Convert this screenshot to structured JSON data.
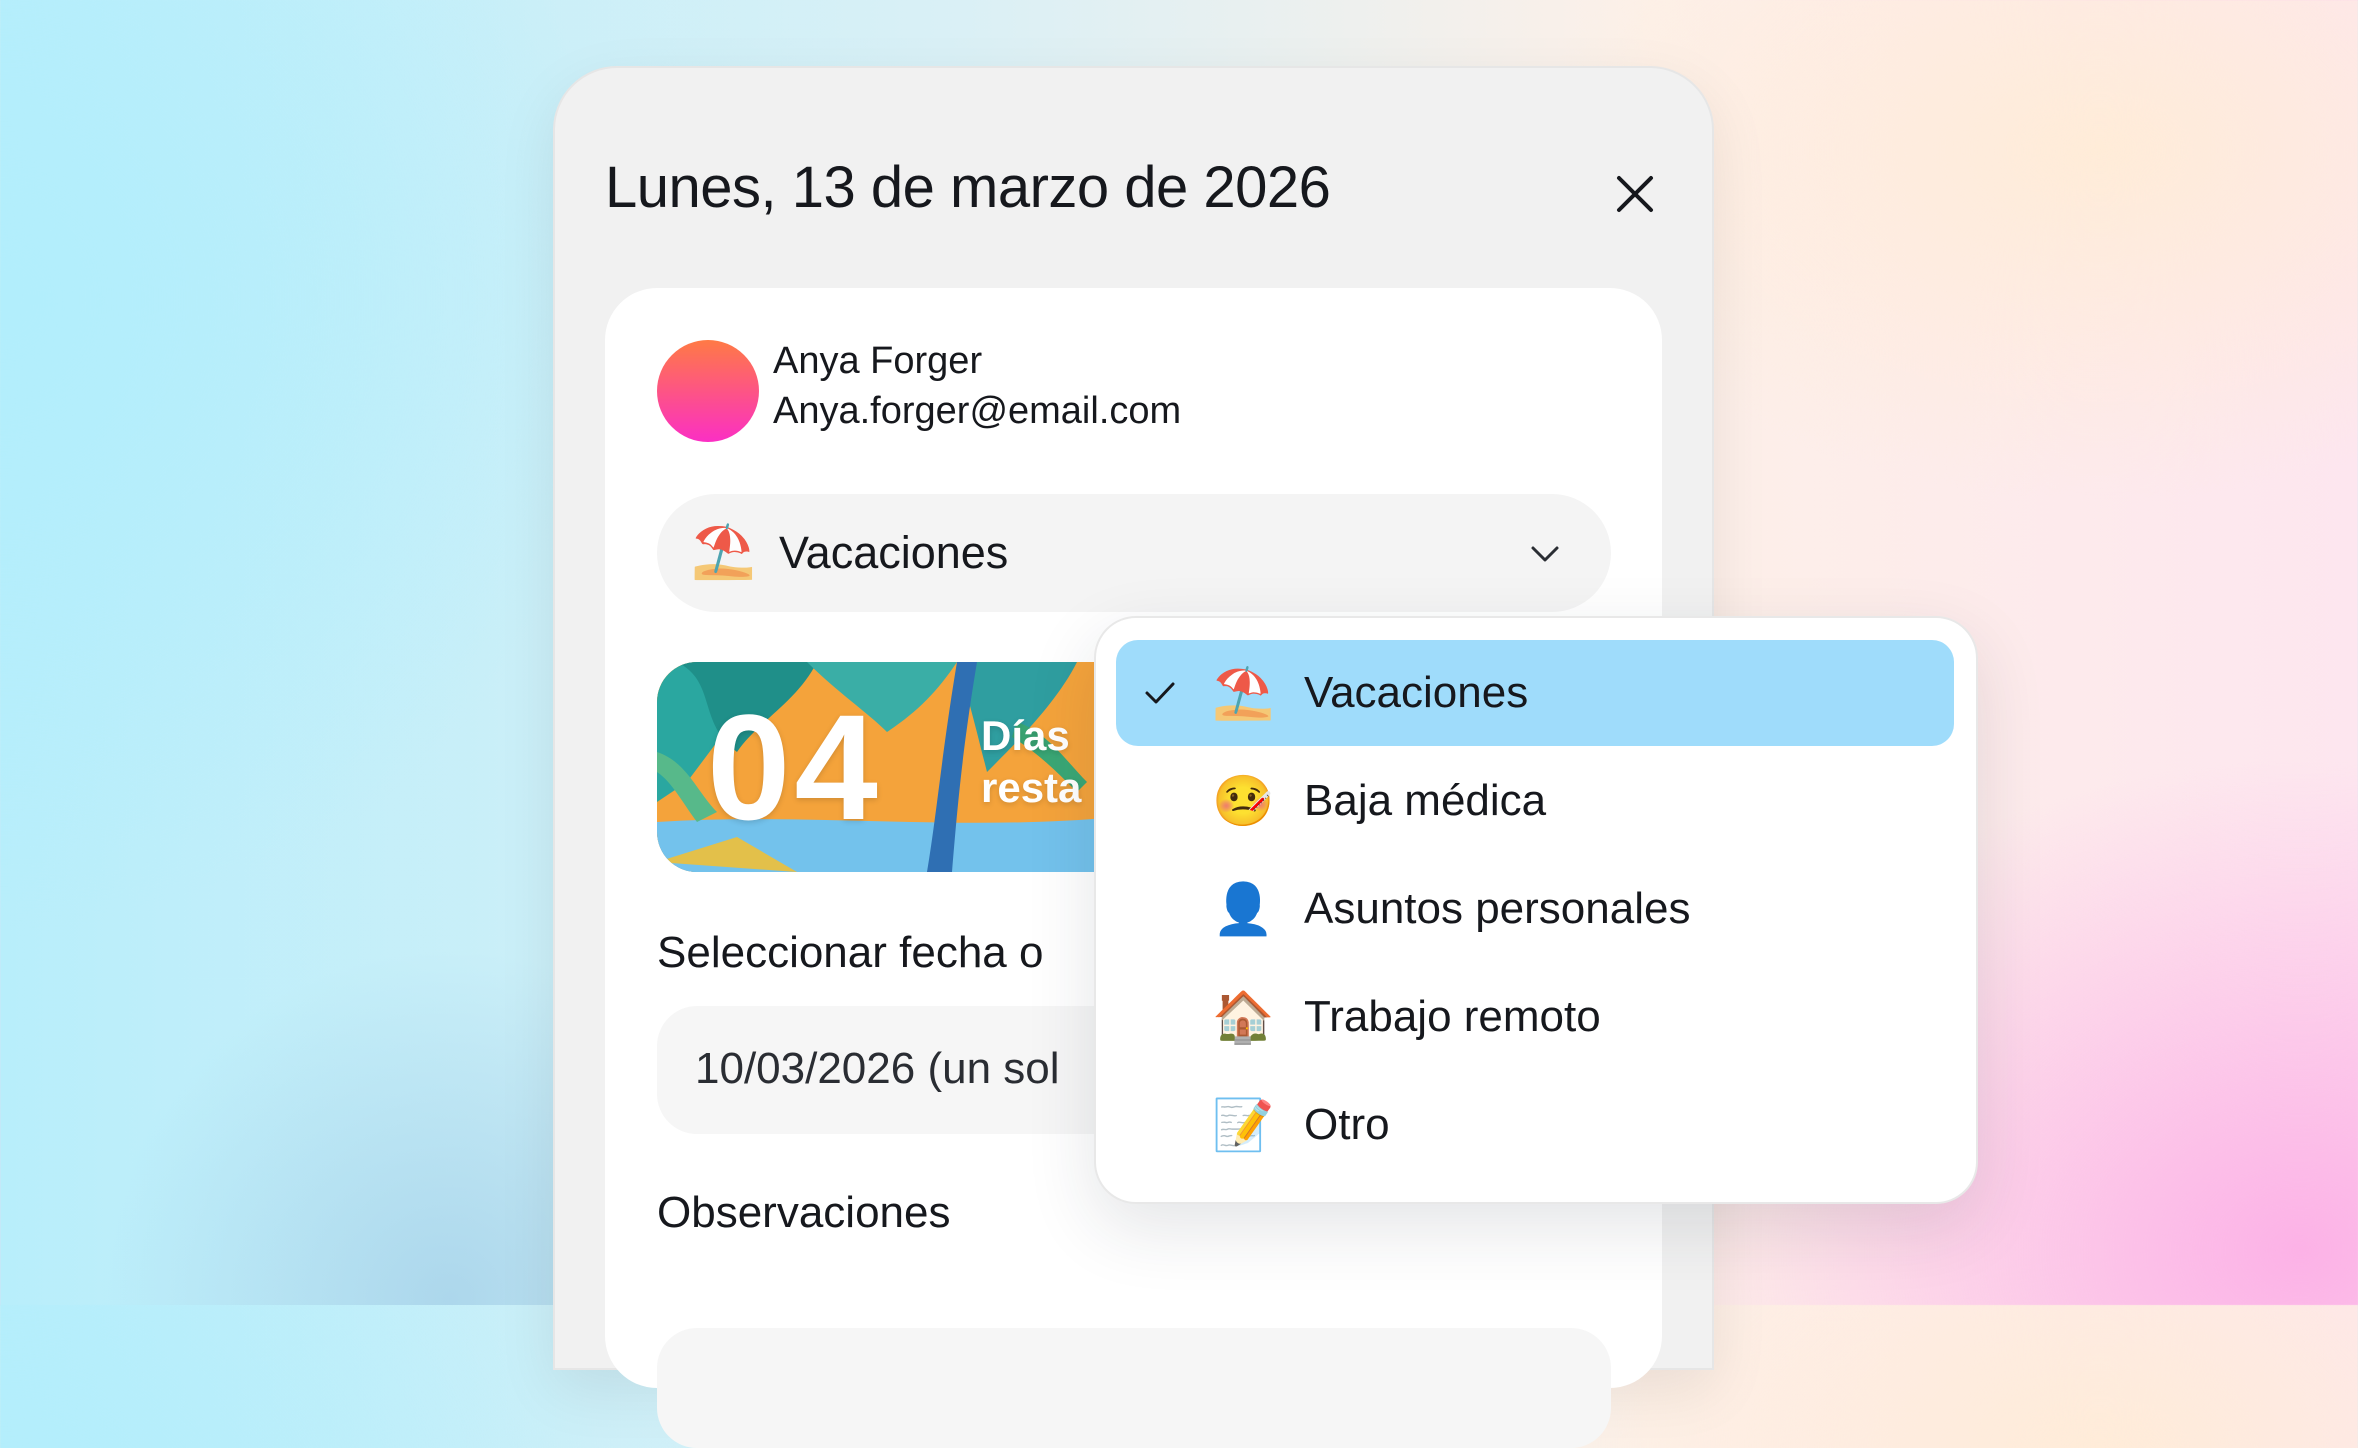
{
  "header": {
    "title": "Lunes, 13 de marzo de 2026"
  },
  "user": {
    "name": "Anya Forger",
    "email": "Anya.forger@email.com"
  },
  "absence_type": {
    "selected_emoji": "⛱️",
    "selected_label": "Vacaciones"
  },
  "banner": {
    "days": "04",
    "text_line1": "Días",
    "text_line2": "resta"
  },
  "date_section": {
    "label": "Seleccionar fecha o",
    "value": "10/03/2026 (un sol"
  },
  "notes_section": {
    "label": "Observaciones"
  },
  "dropdown": {
    "items": [
      {
        "emoji": "⛱️",
        "label": "Vacaciones",
        "selected": true
      },
      {
        "emoji": "🤒",
        "label": "Baja médica",
        "selected": false
      },
      {
        "emoji": "👤",
        "label": "Asuntos personales",
        "selected": false
      },
      {
        "emoji": "🏠",
        "label": "Trabajo remoto",
        "selected": false
      },
      {
        "emoji": "📝",
        "label": "Otro",
        "selected": false
      }
    ]
  },
  "colors": {
    "selected_item_bg": "#9fdcfb",
    "avatar_gradient_top": "#ff7a45",
    "avatar_gradient_bottom": "#fb2fc4"
  }
}
